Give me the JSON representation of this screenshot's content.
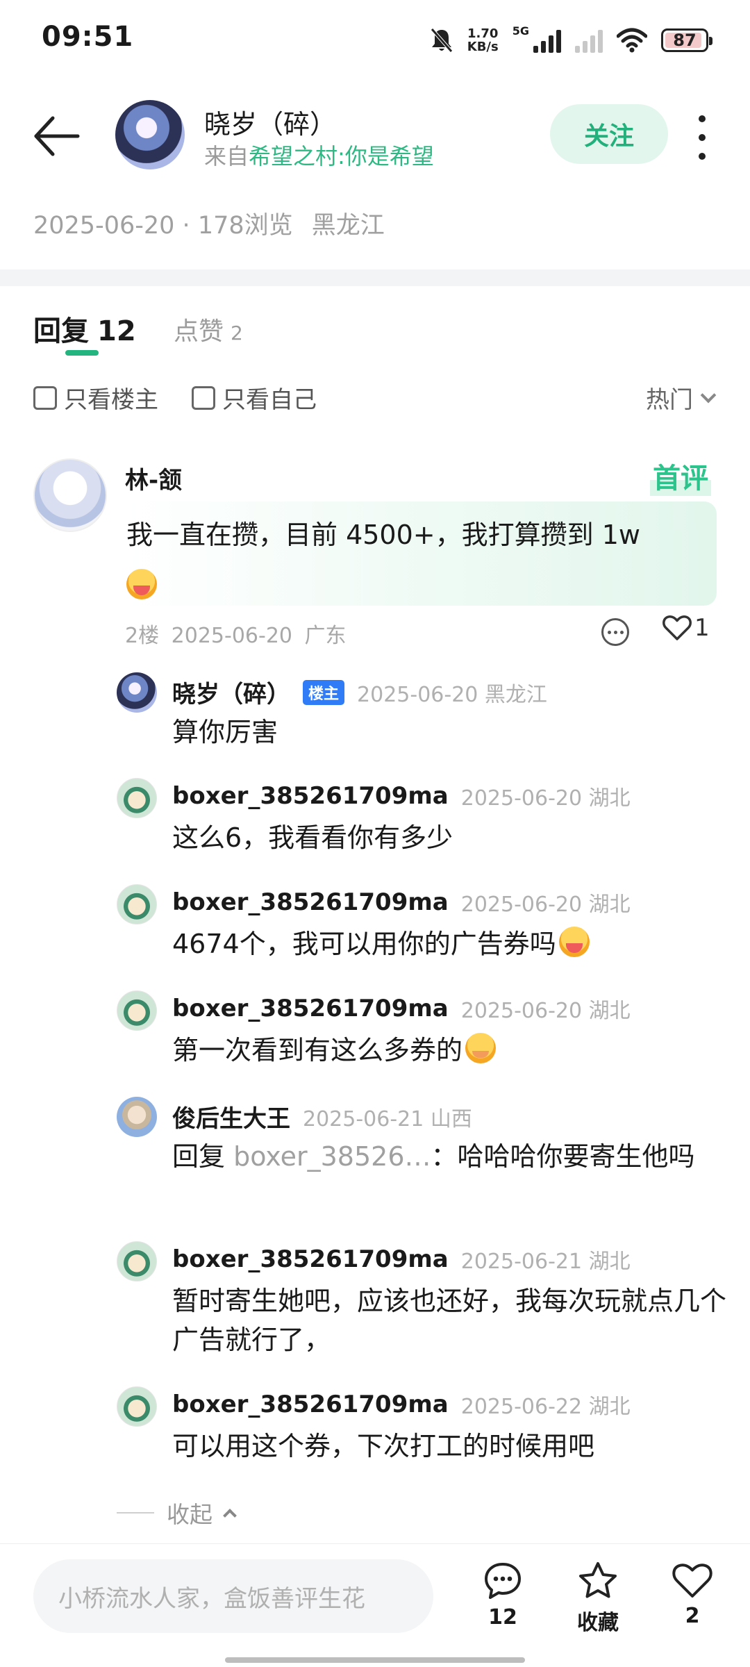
{
  "status_bar": {
    "time": "09:51",
    "net_speed_value": "1.70",
    "net_speed_unit": "KB/s",
    "network": "5G",
    "battery": "87"
  },
  "header": {
    "author_name": "晓岁（碎）",
    "from_prefix": "来自",
    "from_group": "希望之村:你是希望",
    "follow_label": "关注"
  },
  "meta": {
    "date": "2025-06-20",
    "views": "178浏览",
    "location": "黑龙江"
  },
  "tabs": {
    "reply_label": "回复",
    "reply_count": "12",
    "like_label": "点赞",
    "like_count": "2"
  },
  "filters": {
    "only_op": "只看楼主",
    "only_me": "只看自己",
    "sort": "热门"
  },
  "main_comment": {
    "author": "林-颔",
    "badge": "首评",
    "text": "我一直在攒，目前 4500+，我打算攒到 1w",
    "emoji": "hug-face",
    "floor": "2楼",
    "date": "2025-06-20",
    "location": "广东",
    "likes": "1"
  },
  "replies": [
    {
      "author": "晓岁（碎）",
      "host_badge": "楼主",
      "date": "2025-06-20",
      "location": "黑龙江",
      "text": "算你厉害"
    },
    {
      "author": "boxer_385261709ma",
      "date": "2025-06-20",
      "location": "湖北",
      "text": "这么6，我看看你有多少"
    },
    {
      "author": "boxer_385261709ma",
      "date": "2025-06-20",
      "location": "湖北",
      "text": "4674个，我可以用你的广告券吗"
    },
    {
      "author": "boxer_385261709ma",
      "date": "2025-06-20",
      "location": "湖北",
      "text": "第一次看到有这么多券的"
    },
    {
      "author": "俊后生大王",
      "date": "2025-06-21",
      "location": "山西",
      "reply_prefix": "回复 ",
      "reply_target": "boxer_38526…",
      "text": "：哈哈哈你要寄生他吗"
    },
    {
      "author": "boxer_385261709ma",
      "date": "2025-06-21",
      "location": "湖北",
      "text": "暂时寄生她吧，应该也还好，我每次玩就点几个广告就行了，"
    },
    {
      "author": "boxer_385261709ma",
      "date": "2025-06-22",
      "location": "湖北",
      "text": "可以用这个券，下次打工的时候用吧"
    }
  ],
  "collapse_label": "收起",
  "bottom_bar": {
    "input_placeholder": "小桥流水人家，盒饭善评生花",
    "comment_count": "12",
    "favorite_label": "收藏",
    "like_count": "2"
  },
  "colors": {
    "accent_green": "#24b47f",
    "host_badge_blue": "#2f7cf6"
  }
}
